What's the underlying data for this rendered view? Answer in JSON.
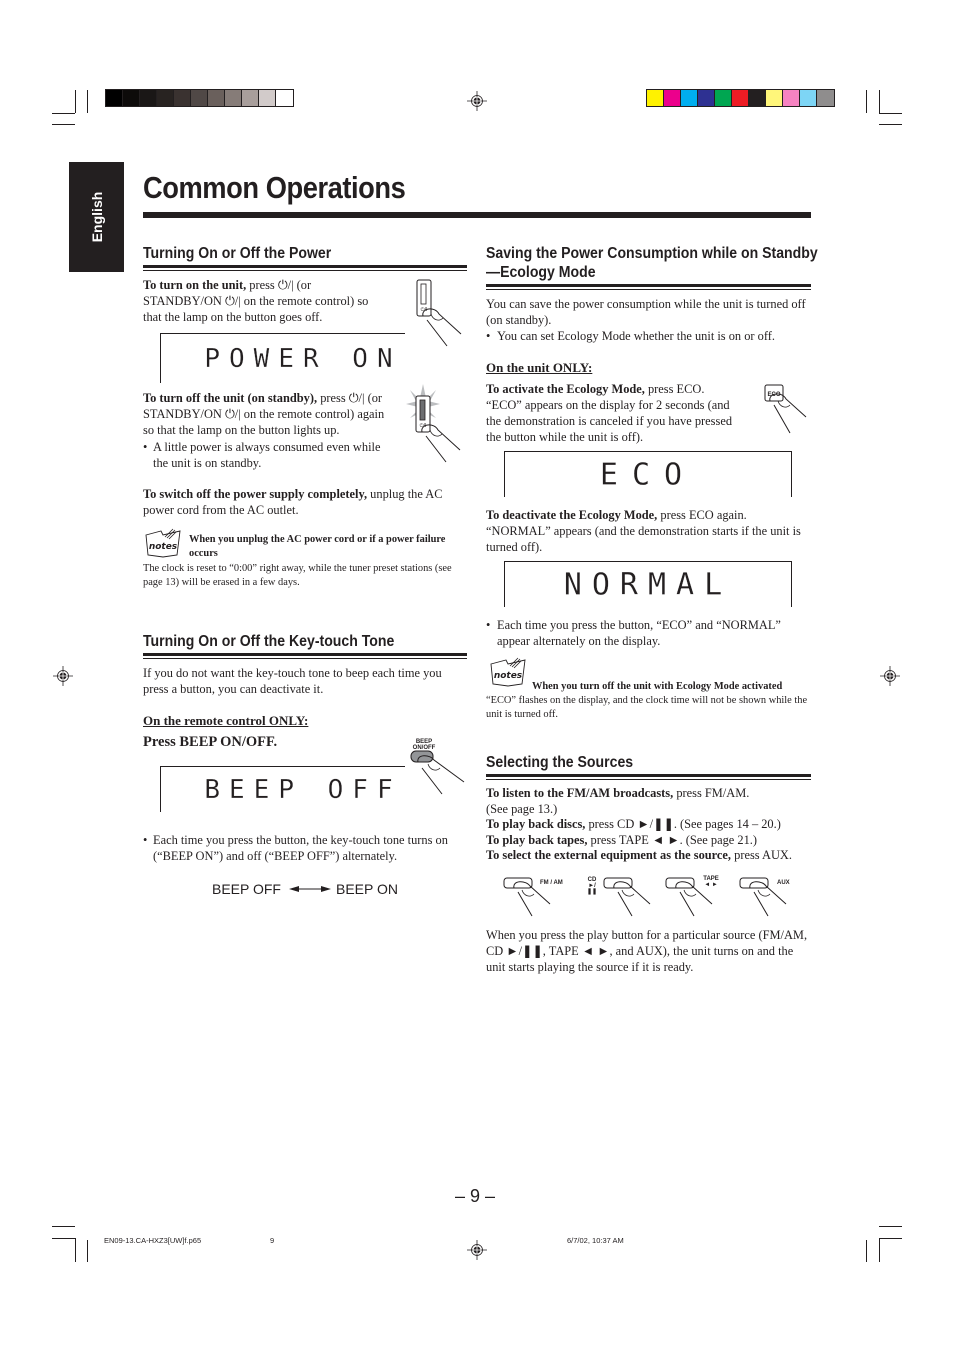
{
  "side_tab": {
    "label": "English"
  },
  "page_title": "Common Operations",
  "color_bars": {
    "grayscale": [
      "#000000",
      "#0d0b0a",
      "#1a1716",
      "#282321",
      "#3a3230",
      "#504846",
      "#6a605c",
      "#867c78",
      "#a89e9b",
      "#d2cbca",
      "#ffffff"
    ],
    "process": [
      "#fff200",
      "#ec008c",
      "#00aeef",
      "#2e3192",
      "#00a651",
      "#ed1c24",
      "#231f20",
      "#fff67a",
      "#f683c1",
      "#7dd5f5",
      "#8f8d8d"
    ]
  },
  "power_section": {
    "title": "Turning On or Off the Power",
    "turn_on_bold": "To turn on the unit,",
    "turn_on_rest": " press ⏻/| (or STANDBY/ON ⏻/| on the remote control) so that the lamp on the button goes off.",
    "display_on": "POWER ON",
    "turn_off_bold": "To turn off the unit (on standby),",
    "turn_off_rest": " press ⏻/| (or STANDBY/ON ⏻/| on the remote control) again so that the lamp on the button lights up.",
    "bullet": "A little power is always consumed even while the unit is on standby.",
    "switch_off_bold": "To switch off the power supply completely,",
    "switch_off_rest": " unplug the AC power cord from the AC outlet.",
    "note_title": "When you unplug the AC power cord or if a power failure occurs",
    "note_body": "The clock is reset to “0:00” right away, while the tuner preset stations (see page 13) will be erased in a few days.",
    "button_label": "⏻/|"
  },
  "beep_section": {
    "title": "Turning On or Off the Key-touch Tone",
    "intro": "If you do not want the key-touch tone to beep each time you press a button, you can deactivate it.",
    "subhead": "On the remote control ONLY:",
    "instruction": "Press BEEP ON/OFF.",
    "button_label_line1": "BEEP",
    "button_label_line2": "ON/OFF",
    "display": "BEEP OFF",
    "bullet": "Each time you press the button, the key-touch tone turns on (“BEEP ON”) and off (“BEEP OFF”) alternately.",
    "toggle_left": "BEEP OFF",
    "toggle_right": "BEEP ON"
  },
  "eco_section": {
    "title_line1": "Saving the Power Consumption while on Standby",
    "title_line2": "—Ecology Mode",
    "intro": "You can save the power consumption while the unit is turned off (on standby).",
    "bullet": "You can set Ecology Mode whether the unit is on or off.",
    "subhead": "On the unit ONLY:",
    "activate_bold": "To activate the Ecology Mode,",
    "activate_rest": " press ECO. “ECO” appears on the display for 2 seconds (and the demonstration is canceled if you have pressed the button while the unit is off).",
    "button_label": "ECO",
    "display_eco": "ECO",
    "deactivate_bold": "To deactivate the Ecology Mode,",
    "deactivate_rest": " press ECO again. “NORMAL” appears (and the demonstration starts if the unit is turned off).",
    "display_normal": "NORMAL",
    "bullet2": "Each time you press the button, “ECO” and “NORMAL” appear alternately on the display.",
    "note_title": "When you turn off the unit with Ecology Mode activated",
    "note_body": "“ECO” flashes on the display, and the clock time will not be shown while the unit is turned off."
  },
  "sources_section": {
    "title": "Selecting the Sources",
    "lines": [
      {
        "bold": "To listen to the FM/AM broadcasts,",
        "rest": " press FM/AM."
      },
      {
        "bold": "",
        "rest": "(See page 13.)"
      },
      {
        "bold": "To play back discs,",
        "rest": " press CD ►/❚❚. (See pages 14 – 20.)"
      },
      {
        "bold": "To play back tapes,",
        "rest": " press TAPE ◄ ►. (See page 21.)"
      },
      {
        "bold": "To select the external equipment as the source,",
        "rest": " press AUX."
      }
    ],
    "buttons": [
      {
        "label": "FM / AM"
      },
      {
        "label": "CD ►/❚❚"
      },
      {
        "label": "TAPE ◄ ►"
      },
      {
        "label": "AUX"
      }
    ],
    "closing": "When you press the play button for a particular source (FM/AM, CD ►/❚❚, TAPE ◄ ►, and AUX), the unit turns on and the unit starts playing the source if it is ready."
  },
  "notes_label": "notes",
  "page_number": "– 9 –",
  "footer": {
    "file": "EN09-13.CA-HXZ3[UW]f.p65",
    "page": "9",
    "timestamp": "6/7/02, 10:37 AM"
  }
}
